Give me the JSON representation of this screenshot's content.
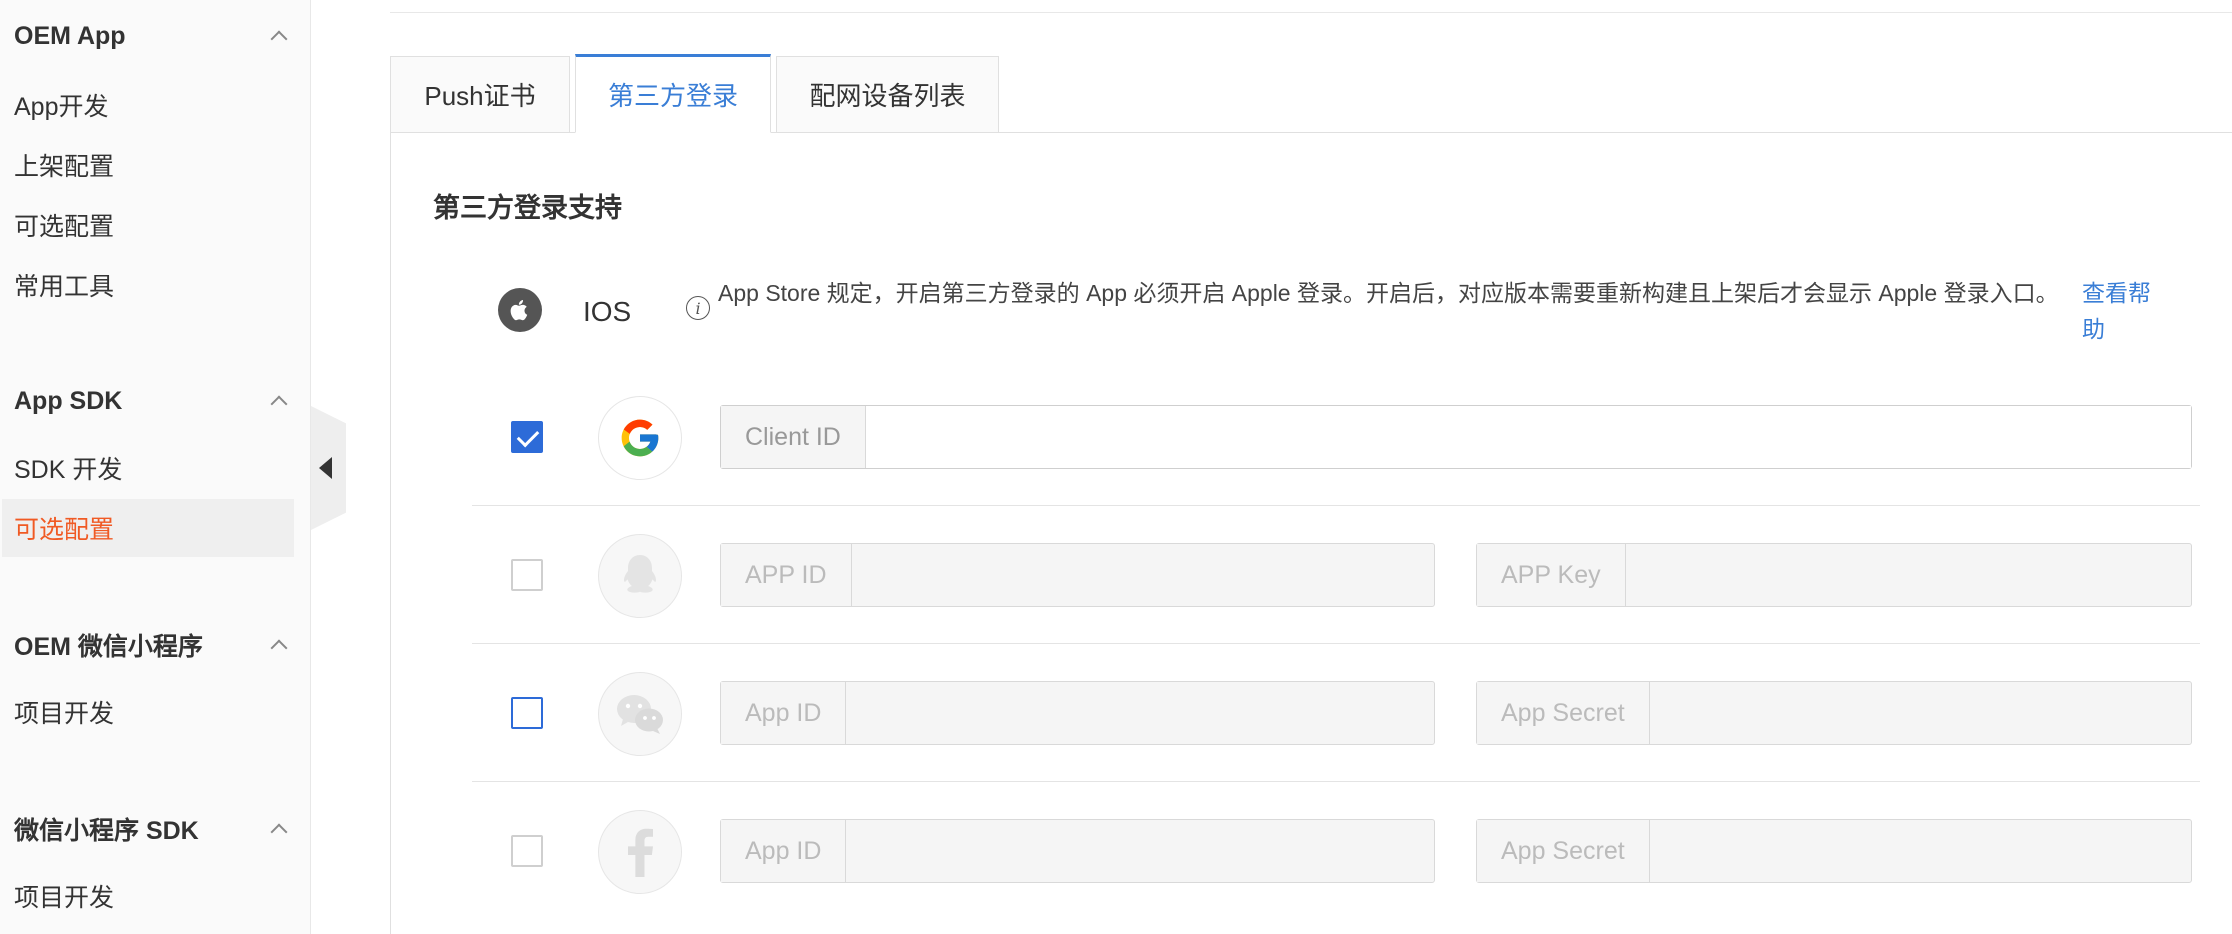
{
  "sidebar": {
    "groups": [
      {
        "title": "OEM App",
        "items": [
          "App开发",
          "上架配置",
          "可选配置",
          "常用工具"
        ]
      },
      {
        "title": "App SDK",
        "items": [
          "SDK 开发",
          "可选配置"
        ]
      },
      {
        "title": "OEM 微信小程序",
        "items": [
          "项目开发"
        ]
      },
      {
        "title": "微信小程序 SDK",
        "items": [
          "项目开发"
        ]
      }
    ],
    "active_item": "App SDK / 可选配置",
    "accent_color": "#f05a24"
  },
  "tabs": [
    {
      "label": "Push证书",
      "active": false
    },
    {
      "label": "第三方登录",
      "active": true
    },
    {
      "label": "配网设备列表",
      "active": false
    }
  ],
  "section": {
    "title": "第三方登录支持",
    "ios": {
      "label": "IOS",
      "note": "App Store 规定，开启第三方登录的 App 必须开启 Apple 登录。开启后，对应版本需要重新构建且上架后才会显示 Apple 登录入口。",
      "help_link": "查看帮助"
    },
    "providers": [
      {
        "icon": "google-icon",
        "checked": true,
        "enabled": true,
        "fields": [
          "Client ID"
        ]
      },
      {
        "icon": "qq-icon",
        "checked": false,
        "enabled": false,
        "fields": [
          "APP ID",
          "APP Key"
        ]
      },
      {
        "icon": "wechat-icon",
        "checked": false,
        "enabled": false,
        "fields": [
          "App ID",
          "App Secret"
        ]
      },
      {
        "icon": "facebook-icon",
        "checked": false,
        "enabled": false,
        "fields": [
          "App ID",
          "App Secret"
        ]
      }
    ]
  },
  "colors": {
    "primary": "#3a7ed6",
    "checkbox": "#2d6bd8"
  }
}
